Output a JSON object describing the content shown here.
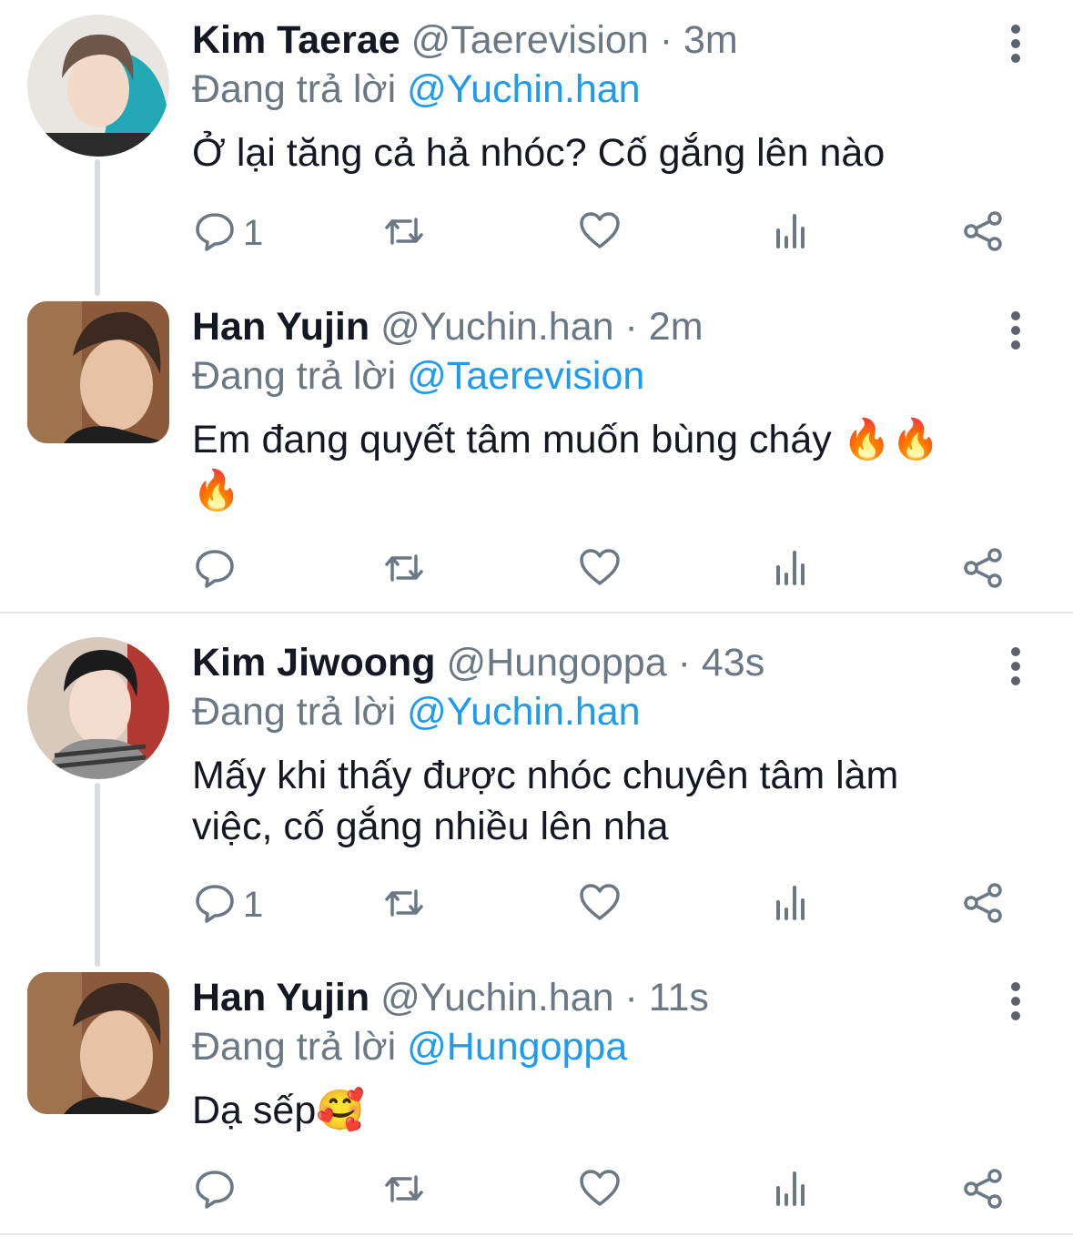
{
  "tweets": [
    {
      "name": "Kim Taerae",
      "handle": "@Taerevision",
      "dot": "·",
      "time": "3m",
      "reply_prefix": "Đang trả lời",
      "reply_to": "@Yuchin.han",
      "text_lines": [
        "Ở lại tăng cả hả nhóc? Cố gắng lên nào"
      ],
      "reply_count": "1"
    },
    {
      "name": "Han Yujin",
      "handle": "@Yuchin.han",
      "dot": "·",
      "time": "2m",
      "reply_prefix": "Đang trả lời",
      "reply_to": "@Taerevision",
      "text_lines": [
        "Em đang quyết tâm muốn bùng cháy 🔥🔥",
        "🔥"
      ],
      "reply_count": ""
    },
    {
      "name": "Kim Jiwoong",
      "handle": "@Hungoppa",
      "dot": "·",
      "time": "43s",
      "reply_prefix": "Đang trả lời",
      "reply_to": "@Yuchin.han",
      "text_lines": [
        "Mấy khi thấy được nhóc chuyên tâm làm",
        "việc, cố gắng nhiều lên nha"
      ],
      "reply_count": "1"
    },
    {
      "name": "Han Yujin",
      "handle": "@Yuchin.han",
      "dot": "·",
      "time": "11s",
      "reply_prefix": "Đang trả lời",
      "reply_to": "@Hungoppa",
      "text_lines": [
        "Dạ sếp🥰"
      ],
      "reply_count": ""
    }
  ],
  "icons": {
    "reply": "reply-icon",
    "retweet": "retweet-icon",
    "like": "heart-icon",
    "views": "views-icon",
    "share": "share-icon",
    "more": "more-vertical-icon"
  },
  "colors": {
    "mention": "#1d9bf0",
    "secondary_text": "#6b7783",
    "primary_text": "#141823",
    "thread_line": "#d9dde1"
  }
}
